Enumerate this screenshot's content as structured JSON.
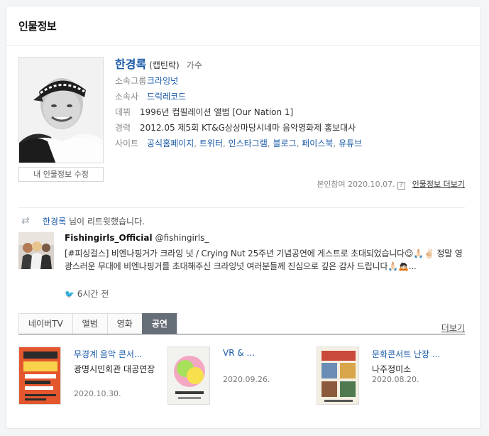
{
  "section_title": "인물정보",
  "profile": {
    "name": "한경록",
    "name_en": "(캡틴락)",
    "job": "가수",
    "edit_label": "내 인물정보 수정",
    "group_label": "소속그룹",
    "group_value": "크라잉넛",
    "agency_label": "소속사",
    "agency_value": "드럭레코드",
    "debut_label": "데뷔",
    "debut_value": "1996년 컴필레이션 앨범 [Our Nation 1]",
    "career_label": "경력",
    "career_value": "2012.05 제5회 KT&G상상마당시네마 음악영화제 홍보대사",
    "sites_label": "사이트",
    "sites": [
      "공식홈페이지",
      "트위터",
      "인스타그램",
      "블로그",
      "페이스북",
      "유튜브"
    ],
    "participation": "본인참여 2020.10.07.",
    "help_icon_text": "?",
    "more_info_label": "인물정보 더보기"
  },
  "tweet": {
    "retweeter": "한경록",
    "retweet_suffix": "님이 리트윗했습니다.",
    "author": "Fishingirls_Official",
    "handle": "@fishingirls_",
    "body": "[#피싱걸스] 비엔나핑거가 크라잉 넛 / Crying Nut 25주년 기념공연에 게스트로 초대되었습니다☺🙏🏻✌🏻 정말 영광스러운 무대에 비엔나핑거를 초대해주신 크라잉넛 여러분들께 진심으로 깊은 감사 드립니다🙏🏻🙇🏻...",
    "time": "6시간 전"
  },
  "tabs": [
    "네이버TV",
    "앨범",
    "영화",
    "공연"
  ],
  "active_tab": "공연",
  "more_label": "더보기",
  "shows": [
    {
      "title": "무경계 음악 콘서...",
      "place": "광명시민회관 대공연장",
      "date": "2020.10.30."
    },
    {
      "title": "VR & ...",
      "place": "",
      "date": "2020.09.26."
    },
    {
      "title": "문화콘서트 난장 ...",
      "place": "나주정미소",
      "date": "2020.08.20."
    }
  ],
  "colors": {
    "link": "#1a5aa8",
    "active_tab": "#666e78",
    "twitter": "#1da1f2"
  }
}
